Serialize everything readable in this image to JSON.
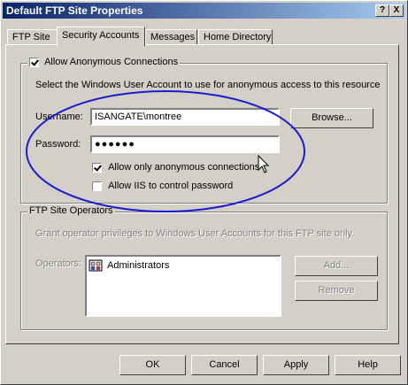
{
  "window": {
    "title": "Default FTP Site Properties",
    "help_btn": "?",
    "close_btn": "X"
  },
  "tabs": [
    {
      "label": "FTP Site",
      "active": false
    },
    {
      "label": "Security Accounts",
      "active": true
    },
    {
      "label": "Messages",
      "active": false
    },
    {
      "label": "Home Directory",
      "active": false
    }
  ],
  "anonymous": {
    "group_label": "Allow Anonymous Connections",
    "group_checked": true,
    "description": "Select the Windows User Account to use for anonymous access to this resource",
    "username_label": "Username:",
    "username_value": "ISANGATE\\montree",
    "browse_label": "Browse...",
    "password_label": "Password:",
    "password_value": "●●●●●●",
    "only_anon_label": "Allow only anonymous connections",
    "only_anon_checked": true,
    "iis_pwd_label": "Allow IIS to control password",
    "iis_pwd_checked": false
  },
  "operators": {
    "group_label": "FTP Site Operators",
    "description": "Grant operator privileges to Windows User Accounts for this FTP site only.",
    "operators_label": "Operators:",
    "items": [
      "Administrators"
    ],
    "add_label": "Add...",
    "remove_label": "Remove"
  },
  "footer": {
    "ok_label": "OK",
    "cancel_label": "Cancel",
    "apply_label": "Apply",
    "help_label": "Help"
  },
  "colors": {
    "annotation_ellipse": "#1a1ad0",
    "titlebar": "#0a246a"
  }
}
